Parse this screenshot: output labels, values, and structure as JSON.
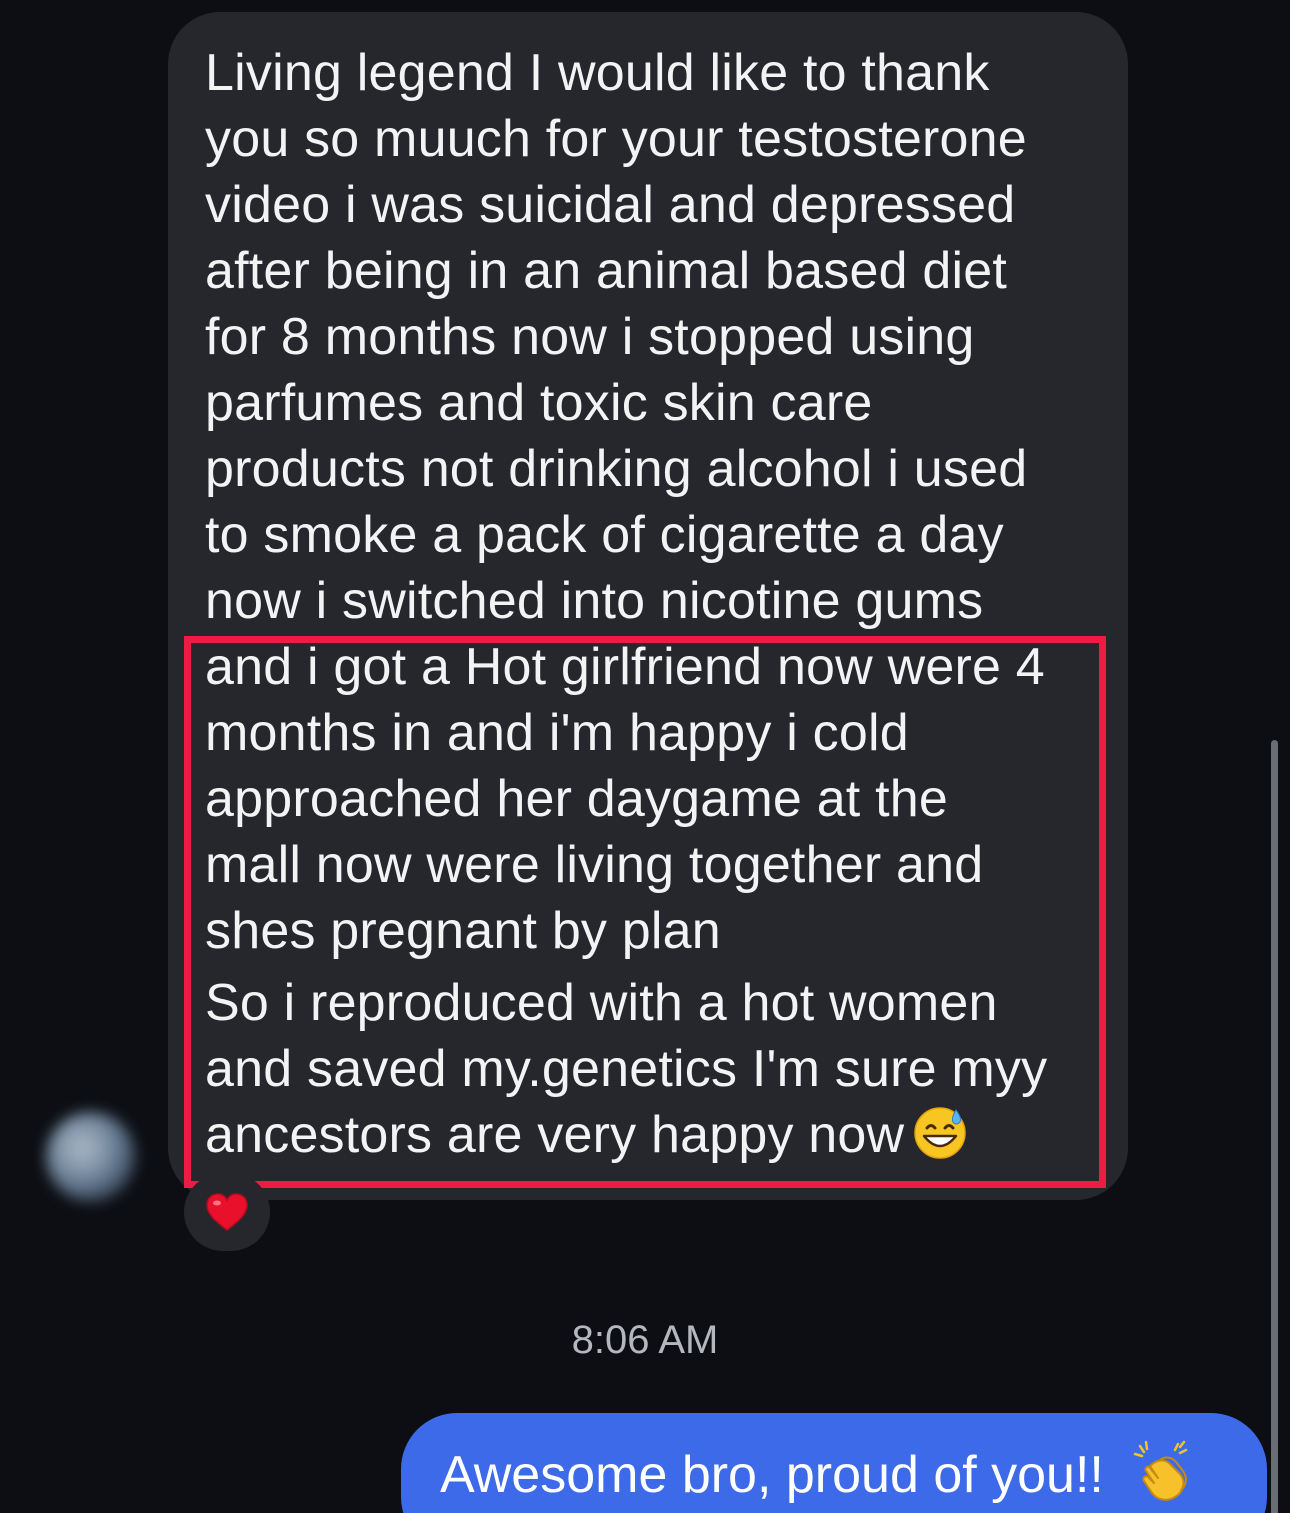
{
  "incoming_message": {
    "lines_before_highlight": [
      "Living legend I would like to thank",
      "you so muuch for your testosterone",
      "video i was suicidal and depressed",
      "after being in an animal based diet",
      "for 8 months now i stopped using",
      "parfumes and toxic skin care",
      "products not drinking alcohol i used",
      "to smoke a pack of cigarette a day",
      "now i switched into nicotine gums"
    ],
    "highlighted_lines": [
      "and i got a Hot girlfriend now were 4",
      "months in and i'm happy i cold",
      "approached her daygame at the",
      "mall now were living together and",
      "shes pregnant by plan",
      "So i reproduced with a hot women",
      "and saved my.genetics I'm sure myy",
      "ancestors are very happy now"
    ],
    "trailing_emoji": "grinning-sweat-emoji",
    "reaction": "heart-reaction",
    "highlight_color": "#ee1c45"
  },
  "timestamp": "8:06 AM",
  "outgoing_message": {
    "text": "Awesome bro, proud of you!!",
    "emoji": "clapping-hands-emoji",
    "bubble_color": "#3d6ae8"
  }
}
